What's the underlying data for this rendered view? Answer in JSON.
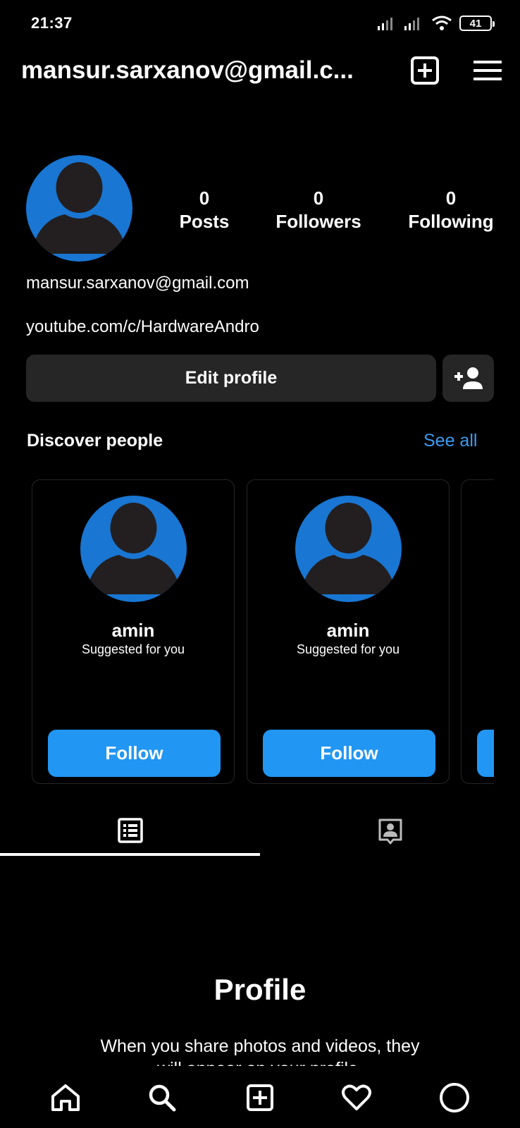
{
  "status_bar": {
    "time": "21:37",
    "battery": "41"
  },
  "header": {
    "username": "mansur.sarxanov@gmail.c...",
    "new_post_icon": "plus-square-icon",
    "menu_icon": "hamburger-menu-icon"
  },
  "profile": {
    "stats": [
      {
        "value": "0",
        "label": "Posts"
      },
      {
        "value": "0",
        "label": "Followers"
      },
      {
        "value": "0",
        "label": "Following"
      }
    ],
    "bio_name": "mansur.sarxanov@gmail.com",
    "bio_link": "youtube.com/c/HardwareAndro",
    "edit_button": "Edit profile"
  },
  "discover": {
    "title": "Discover people",
    "see_all": "See all",
    "cards": [
      {
        "name": "amin",
        "subtitle": "Suggested for you",
        "button": "Follow"
      },
      {
        "name": "amin",
        "subtitle": "Suggested for you",
        "button": "Follow"
      }
    ]
  },
  "empty_state": {
    "title": "Profile",
    "text": "When you share photos and videos, they will appear on your profile."
  },
  "colors": {
    "accent": "#2196f3",
    "link": "#3a9cf2",
    "avatar": "#1976d2",
    "button_bg": "#262626"
  }
}
